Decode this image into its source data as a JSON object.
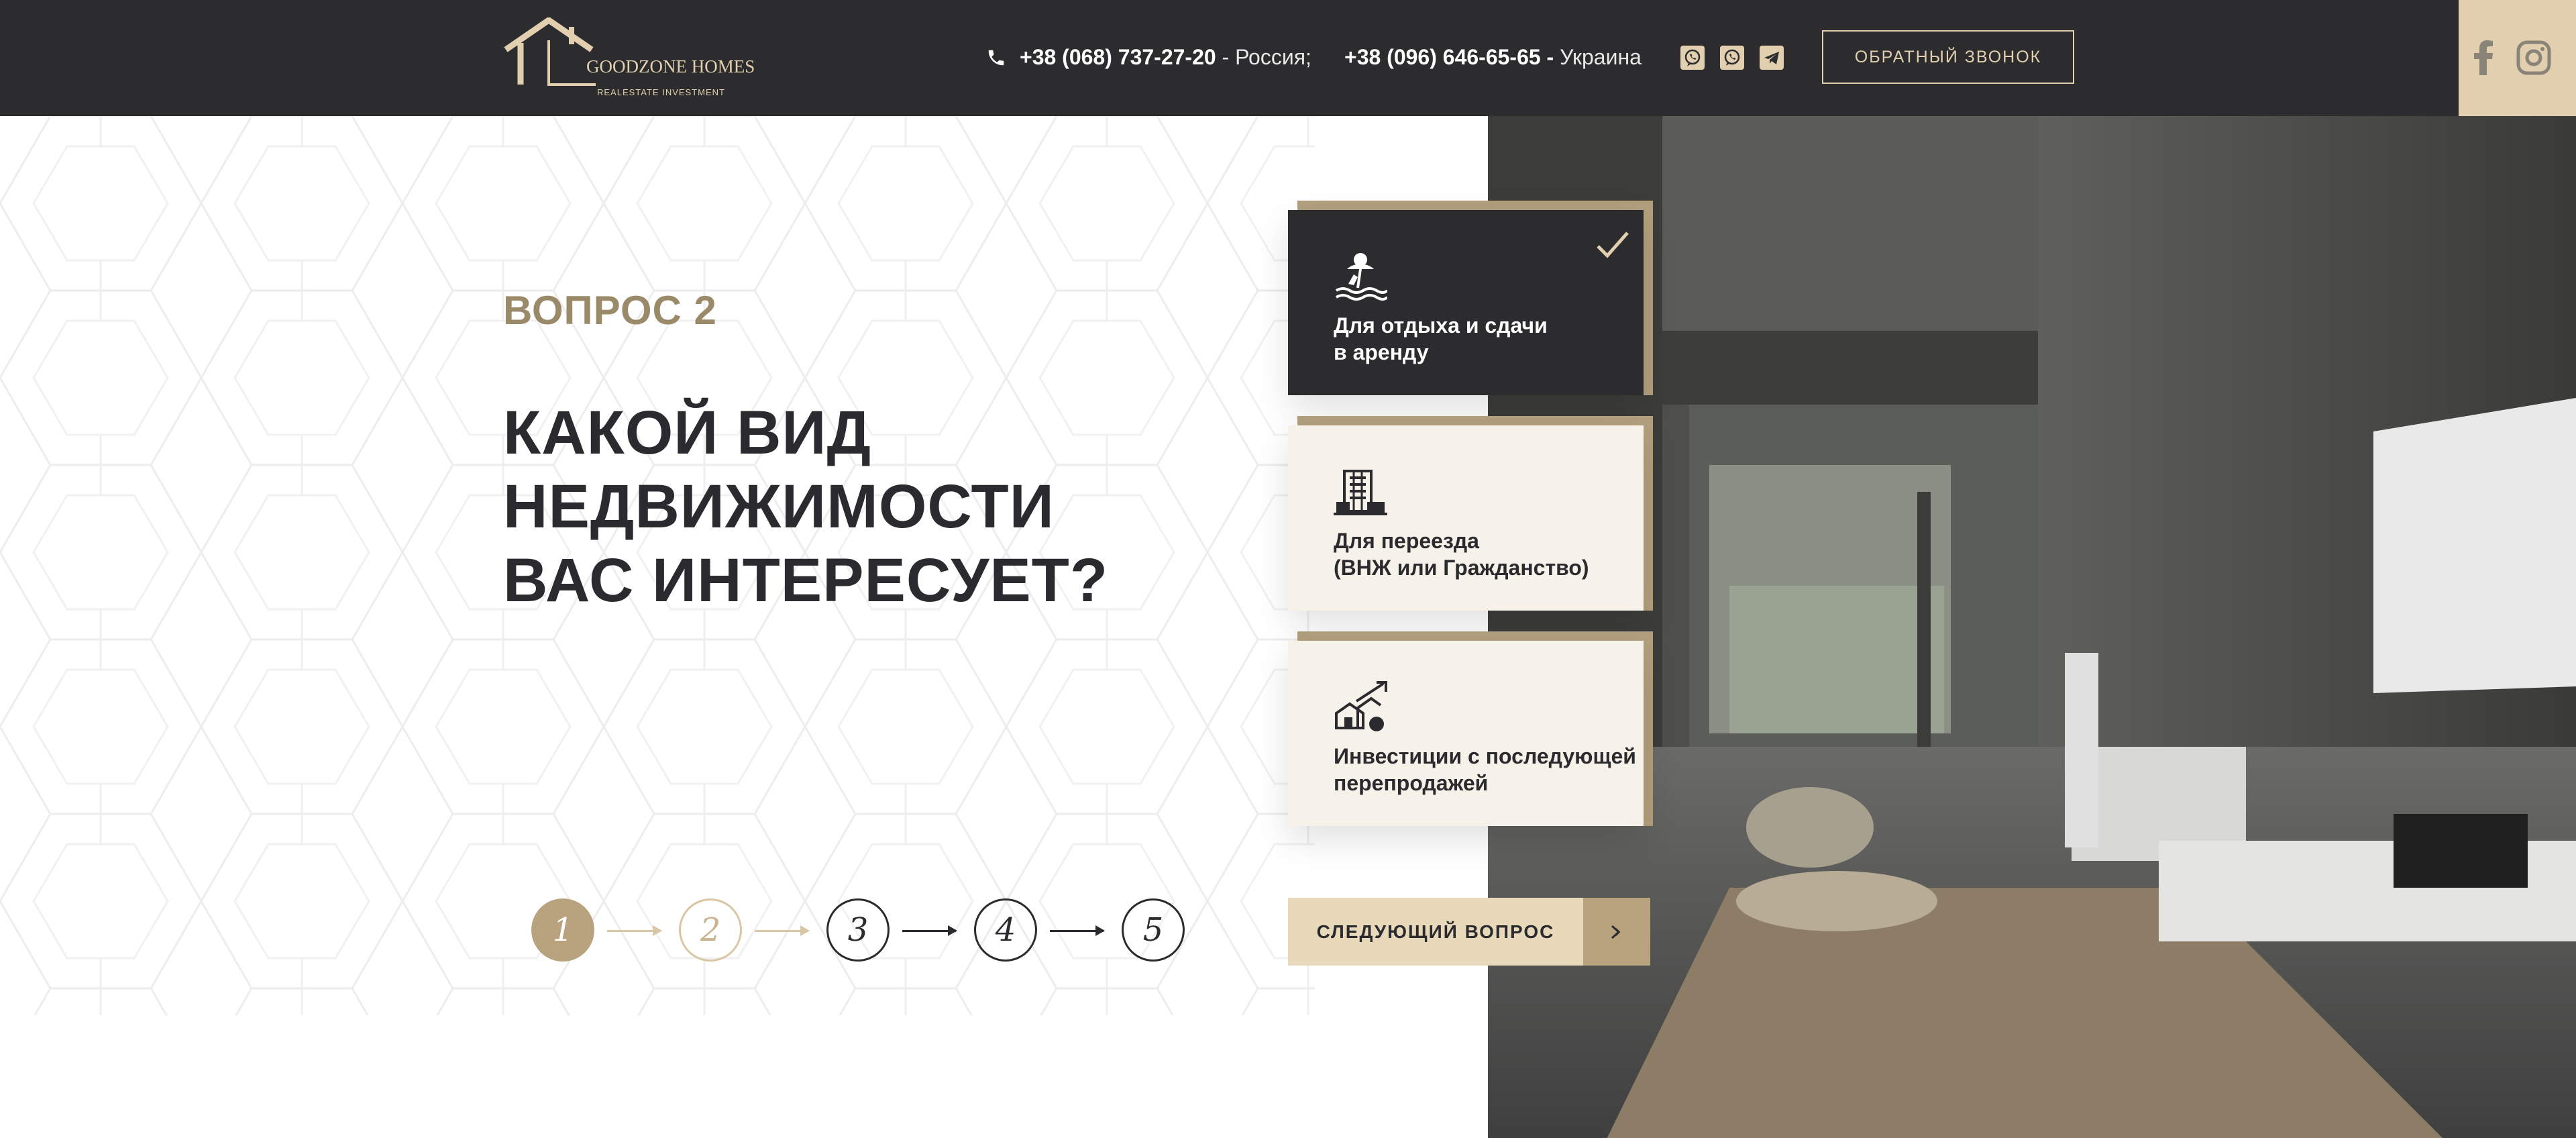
{
  "header": {
    "logo": {
      "name": "GOODZONE HOMES",
      "tagline": "REALESTATE INVESTMENT"
    },
    "phones": [
      {
        "number": "+38 (068) 737-27-20",
        "country": "- Россия;"
      },
      {
        "number": "+38 (096) 646-65-65 -",
        "country": "Украина"
      }
    ],
    "messenger_icons": [
      "viber-icon",
      "whatsapp-icon",
      "telegram-icon"
    ],
    "callback_label": "ОБРАТНЫЙ ЗВОНОК",
    "social_icons": [
      "facebook-icon",
      "instagram-icon"
    ]
  },
  "quiz": {
    "question_number": "ВОПРОС 2",
    "question_title": "КАКОЙ ВИД НЕДВИЖИМОСТИ ВАС ИНТЕРЕСУЕТ?",
    "options": [
      {
        "icon": "beach-icon",
        "label": "Для отдыха и сдачи\nв аренду",
        "selected": true
      },
      {
        "icon": "building-icon",
        "label": "Для переезда\n(ВНЖ или Гражданство)",
        "selected": false
      },
      {
        "icon": "investment-growth-icon",
        "label": "Инвестиции с последующей\nперепродажей",
        "selected": false
      }
    ],
    "steps": [
      "1",
      "2",
      "3",
      "4",
      "5"
    ],
    "current_step": 2,
    "next_button_label": "СЛЕДУЮЩИЙ ВОПРОС"
  },
  "colors": {
    "dark": "#2c2c2f",
    "gold": "#b9a37f",
    "beige": "#e1cfaf",
    "card": "#f6f1e9"
  }
}
